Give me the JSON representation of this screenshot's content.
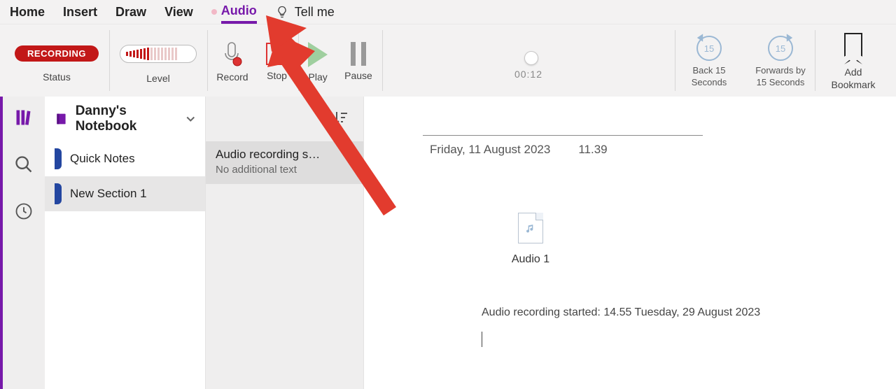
{
  "tabs": {
    "home": "Home",
    "insert": "Insert",
    "draw": "Draw",
    "view": "View",
    "audio": "Audio",
    "tellme": "Tell me"
  },
  "ribbon": {
    "status_badge": "RECORDING",
    "status_label": "Status",
    "level_label": "Level",
    "record": "Record",
    "stop": "Stop",
    "play": "Play",
    "pause": "Pause",
    "time": "00:12",
    "back15": "Back 15 Seconds",
    "fwd15": "Forwards by 15 Seconds",
    "back_num": "15",
    "fwd_num": "15",
    "add_bookmark": "Add Bookmark"
  },
  "notebook": {
    "name": "Danny's Notebook",
    "sections": [
      {
        "label": "Quick Notes"
      },
      {
        "label": "New Section 1"
      }
    ]
  },
  "pages": {
    "items": [
      {
        "title": "Audio recording s…",
        "sub": "No additional text"
      }
    ]
  },
  "page": {
    "date": "Friday, 11 August 2023",
    "time": "11.39",
    "audio_label": "Audio 1",
    "started": "Audio recording started: 14.55 Tuesday, 29 August 2023"
  }
}
